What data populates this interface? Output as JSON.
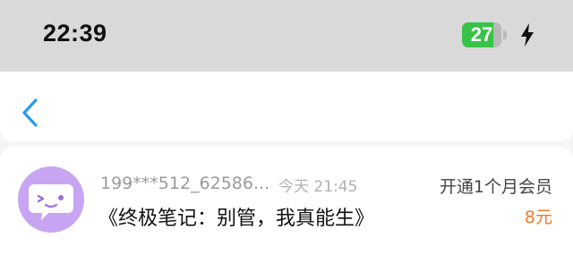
{
  "status_bar": {
    "time": "22:39",
    "battery_level": "27",
    "battery_fraction": 0.27,
    "charging": true,
    "icons": [
      "battery-icon",
      "charging-bolt-icon"
    ],
    "colors": {
      "battery_fill": "#39c24a",
      "background": "#d9d9d9"
    }
  },
  "nav": {
    "back_icon": "chevron-left-icon",
    "accent": "#2b9be6"
  },
  "order": {
    "avatar_icon": "chat-bubble-face-icon",
    "username": "199***512_62586...",
    "timestamp": "今天 21:45",
    "title": "《终极笔记：别管，我真能生》",
    "plan": "开通1个月会员",
    "price": "8元",
    "colors": {
      "avatar_bg": "#c8a5f2",
      "price": "#ee7a24"
    }
  }
}
